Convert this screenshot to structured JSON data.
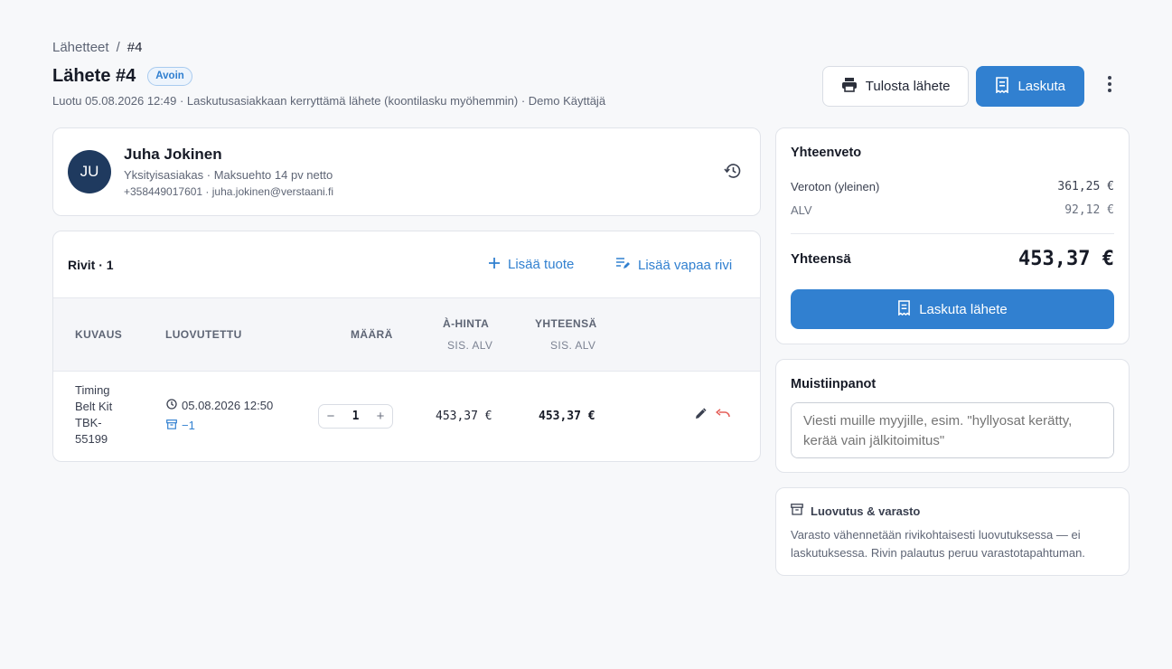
{
  "breadcrumb": {
    "parent": "Lähetteet",
    "separator": "/",
    "current": "#4"
  },
  "header": {
    "title": "Lähete #4",
    "status": "Avoin",
    "subtitle": "Luotu 05.08.2026 12:49 · Laskutusasiakkaan kerryttämä lähete (koontilasku myöhemmin) · Demo Käyttäjä",
    "print_label": "Tulosta lähete",
    "invoice_label": "Laskuta"
  },
  "customer": {
    "initials": "JU",
    "name": "Juha Jokinen",
    "meta": "Yksityisasiakas · Maksuehto 14 pv netto",
    "contact": "+358449017601 · juha.jokinen@verstaani.fi"
  },
  "rows": {
    "title": "Rivit · 1",
    "add_product_label": "Lisää tuote",
    "add_free_row_label": "Lisää vapaa rivi",
    "columns": {
      "description": "KUVAUS",
      "delivered": "LUOVUTETTU",
      "quantity": "MÄÄRÄ",
      "unit_price": "À-HINTA",
      "unit_price_sub": "SIS. ALV",
      "total": "YHTEENSÄ",
      "total_sub": "SIS. ALV"
    },
    "items": [
      {
        "description": "Timing Belt Kit TBK-55199",
        "delivered_at": "05.08.2026 12:50",
        "stock_change": "−1",
        "quantity": "1",
        "unit_price": "453,37 €",
        "total": "453,37 €"
      }
    ]
  },
  "summary": {
    "title": "Yhteenveto",
    "net_label": "Veroton (yleinen)",
    "net_value": "361,25 €",
    "vat_label": "ALV",
    "vat_value": "92,12 €",
    "total_label": "Yhteensä",
    "total_value": "453,37 €",
    "invoice_button": "Laskuta lähete"
  },
  "notes": {
    "title": "Muistiinpanot",
    "placeholder": "Viesti muille myyjille, esim. \"hyllyosat kerätty, kerää vain jälkitoimitus\""
  },
  "delivery_info": {
    "title": "Luovutus & varasto",
    "text": "Varasto vähennetään rivikohtaisesti luovutuksessa — ei laskutuksessa. Rivin palautus peruu varastotapahtuman."
  },
  "colors": {
    "accent": "#3180d0",
    "avatar": "#1f3a5f",
    "undo": "#e5605a"
  }
}
